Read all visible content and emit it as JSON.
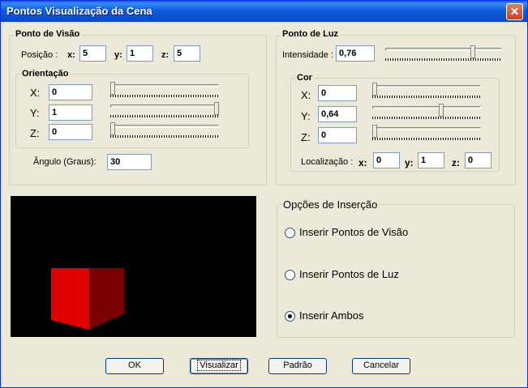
{
  "window": {
    "title": "Pontos Visualização da Cena",
    "close_glyph": "✕"
  },
  "ponto_visao": {
    "title": "Ponto de Visão",
    "posicao_label": "Posição :",
    "x_label": "x:",
    "x_value": "5",
    "y_label": "y:",
    "y_value": "1",
    "z_label": "z:",
    "z_value": "5",
    "orientacao": {
      "title": "Orientação",
      "x_label": "X:",
      "x_value": "0",
      "x_slider": 0.0,
      "y_label": "Y:",
      "y_value": "1",
      "y_slider": 1.0,
      "z_label": "Z:",
      "z_value": "0",
      "z_slider": 0.0
    },
    "angulo_label": "Ângulo (Graus):",
    "angulo_value": "30"
  },
  "ponto_luz": {
    "title": "Ponto de Luz",
    "intensidade_label": "Intensidade :",
    "intensidade_value": "0,76",
    "intensidade_slider": 0.76,
    "cor": {
      "title": "Cor",
      "x_label": "X:",
      "x_value": "0",
      "x_slider": 0.0,
      "y_label": "Y:",
      "y_value": "0,64",
      "y_slider": 0.64,
      "z_label": "Z:",
      "z_value": "0",
      "z_slider": 0.0
    },
    "localizacao_label": "Localização :",
    "x_label": "x:",
    "x_value": "0",
    "y_label": "y:",
    "y_value": "1",
    "z_label": "z:",
    "z_value": "0"
  },
  "opcoes_insercao": {
    "title": "Opções de Inserção",
    "options": [
      {
        "label": "Inserir Pontos de Visão",
        "checked": false
      },
      {
        "label": "Inserir Pontos de Luz",
        "checked": false
      },
      {
        "label": "Inserir Ambos",
        "checked": true
      }
    ]
  },
  "preview": {
    "cube_front_color": "#e10000",
    "cube_side_color": "#7a0000",
    "background": "#000000"
  },
  "buttons": {
    "ok": "OK",
    "visualizar": "Visualizar",
    "padrao": "Padrão",
    "cancelar": "Cancelar"
  }
}
